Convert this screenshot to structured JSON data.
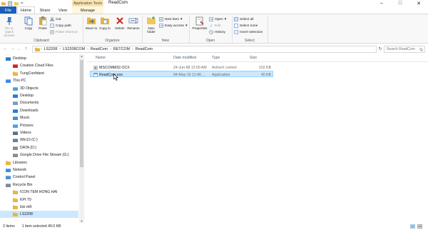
{
  "window": {
    "title": "ReadCom",
    "context_tab": "Application Tools",
    "qat_label": "="
  },
  "tabs": {
    "file": "File",
    "home": "Home",
    "share": "Share",
    "view": "View",
    "manage": "Manage"
  },
  "ribbon": {
    "clipboard": {
      "pin": "Pin to Quick access",
      "copy": "Copy",
      "paste": "Paste",
      "cut": "Cut",
      "copy_path": "Copy path",
      "paste_shortcut": "Paste shortcut",
      "label": "Clipboard"
    },
    "organize": {
      "move_to": "Move to",
      "copy_to": "Copy to",
      "delete": "Delete",
      "rename": "Rename",
      "label": "Organize"
    },
    "new": {
      "new_folder": "New folder",
      "new_item": "New item",
      "easy_access": "Easy access",
      "label": "New"
    },
    "open": {
      "properties": "Properties",
      "open": "Open",
      "edit": "Edit",
      "history": "History",
      "label": "Open"
    },
    "select": {
      "select_all": "Select all",
      "select_none": "Select none",
      "invert": "Invert selection",
      "label": "Select"
    }
  },
  "address": {
    "crumbs": [
      "LS2208",
      "LS2208COM",
      "ReadCom",
      "RETCOM",
      "ReadCom"
    ],
    "search_placeholder": "Search ReadCom"
  },
  "nav": [
    {
      "label": "Desktop",
      "icon": "desktop-icon",
      "color": "#2f79c9"
    },
    {
      "label": "Creative Cloud Files",
      "icon": "creative-cloud-icon",
      "color": "#da1f26"
    },
    {
      "label": "TungConfident",
      "icon": "user-folder-icon",
      "color": "#e8b640"
    },
    {
      "label": "This PC",
      "icon": "computer-icon",
      "color": "#3a8ee6"
    },
    {
      "label": "3D Objects",
      "icon": "3d-objects-icon",
      "color": "#4aa3df"
    },
    {
      "label": "Desktop",
      "icon": "desktop-icon",
      "color": "#2f79c9"
    },
    {
      "label": "Documents",
      "icon": "documents-icon",
      "color": "#7a9bbd"
    },
    {
      "label": "Downloads",
      "icon": "downloads-icon",
      "color": "#2a7bd4"
    },
    {
      "label": "Music",
      "icon": "music-icon",
      "color": "#3a8ee6"
    },
    {
      "label": "Pictures",
      "icon": "pictures-icon",
      "color": "#4aa3df"
    },
    {
      "label": "Videos",
      "icon": "videos-icon",
      "color": "#5b6f86"
    },
    {
      "label": "Win10 (C:)",
      "icon": "drive-icon",
      "color": "#6b7f99"
    },
    {
      "label": "DATA (D:)",
      "icon": "drive-icon",
      "color": "#8b8b8b"
    },
    {
      "label": "Google Drive File Stream (G:)",
      "icon": "google-drive-icon",
      "color": "#8b8b8b"
    },
    {
      "label": "Libraries",
      "icon": "libraries-icon",
      "color": "#e8b640"
    },
    {
      "label": "Network",
      "icon": "network-icon",
      "color": "#3a8ee6"
    },
    {
      "label": "Control Panel",
      "icon": "control-panel-icon",
      "color": "#4a90d9"
    },
    {
      "label": "Recycle Bin",
      "icon": "recycle-bin-icon",
      "color": "#7c8b99"
    },
    {
      "label": "ICON TEM HONG HAI",
      "icon": "folder-icon",
      "color": "#e8b640"
    },
    {
      "label": "KPI T9",
      "icon": "folder-icon",
      "color": "#e8b640"
    },
    {
      "label": "bài viết",
      "icon": "folder-icon",
      "color": "#e8b640"
    },
    {
      "label": "LS2208",
      "icon": "folder-icon",
      "color": "#e8b640"
    }
  ],
  "columns": {
    "name": "Name",
    "date": "Date modified",
    "type": "Type",
    "size": "Size"
  },
  "files": [
    {
      "name": "MSCOMM32.OCX",
      "date": "24-Jun-98 12:00 AM",
      "type": "ActiveX control",
      "size": "102 KB",
      "icon": "ocx-file-icon"
    },
    {
      "name": "ReadCom.exe",
      "date": "04-May-16 11:46 ...",
      "type": "Application",
      "size": "40 KB",
      "icon": "exe-file-icon"
    }
  ],
  "status": {
    "items": "2 items",
    "selected": "1 item selected  40.0 KB"
  }
}
